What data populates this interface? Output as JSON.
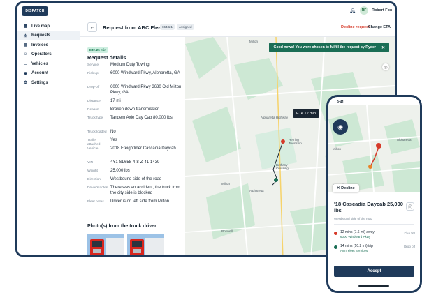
{
  "app": {
    "logo_text": "DISPATCH"
  },
  "sidebar": {
    "items": [
      {
        "label": "Live map",
        "icon": "map-icon"
      },
      {
        "label": "Requests",
        "icon": "warning-icon"
      },
      {
        "label": "Invoices",
        "icon": "invoice-icon"
      },
      {
        "label": "Operators",
        "icon": "operators-icon"
      },
      {
        "label": "Vehicles",
        "icon": "truck-icon"
      },
      {
        "label": "Account",
        "icon": "account-icon"
      },
      {
        "label": "Settings",
        "icon": "gear-icon"
      }
    ],
    "active_index": 1
  },
  "topbar": {
    "user_initials": "RF",
    "user_name": "Robert Fox"
  },
  "request": {
    "title": "Request from ABC Fleet",
    "id": "654321",
    "status": "Assigned",
    "decline_label": "Decline request",
    "eta_label": "Change ETA",
    "eta_badge": "ETA 25 min",
    "section_title": "Request details",
    "rows": [
      {
        "label": "Service",
        "value": "Medium Duty Towing"
      },
      {
        "label": "Pick up",
        "value": "6000 Windward Pkwy, Alpharetta, GA"
      },
      {
        "label": "Drop-off",
        "value": "6000 Windward Pkwy 3630 Old Milton Pkwy, GA"
      },
      {
        "label": "Distance",
        "value": "17 mi"
      },
      {
        "label": "Reason",
        "value": "Broken down transmission"
      },
      {
        "label": "Truck type",
        "value": "Tandem Axle Day Cab 80,000 lbs"
      },
      {
        "label": "Truck loaded",
        "value": "No"
      },
      {
        "label": "Trailer attached",
        "value": "Yes"
      },
      {
        "label": "Vehicle",
        "value": "2018 Freightliner Cascadia Daycab"
      },
      {
        "label": "VIN",
        "value": "4Y1-SL658-4-8-Z-41-1439"
      },
      {
        "label": "Weight",
        "value": "25,000 lbs"
      },
      {
        "label": "Direction",
        "value": "Westbound side of the road"
      },
      {
        "label": "Driver's notes",
        "value": "There was an accident, the truck from the city side is blocked"
      },
      {
        "label": "Fleet notes",
        "value": "Driver is on left side from Milton"
      }
    ],
    "photos_title": "Photo(s) from the truck driver"
  },
  "map": {
    "toast": "Good news! You were chosen to fulfill the request by Ryder",
    "eta_tooltip": "ETA 12 min",
    "labels": [
      "Milton",
      "Alpharetta",
      "Roswell",
      "Crabapple",
      "Alpharetta Highway",
      "Herring Township",
      "Bethany Crossing"
    ]
  },
  "phone": {
    "time": "9:41",
    "decline_label": "Decline",
    "vehicle_title": "'18 Cascadia Daycab 25,000 lbs",
    "direction": "Westbound side of the road",
    "stops": [
      {
        "eta": "12 mins (7.6 mi) away",
        "address": "6000 Windward Pkwy",
        "tag": "Pick Up",
        "color": "#d63a2a"
      },
      {
        "eta": "14 mins (10.2 mi) trip",
        "address": "AMT Fleet Services",
        "tag": "Drop off",
        "color": "#1a6e55"
      }
    ],
    "map_labels": [
      "Alpharetta",
      "Milton",
      "Roswell"
    ],
    "accept_label": "Accept"
  },
  "colors": {
    "brand": "#1f3a5a",
    "danger": "#d63a2a",
    "success": "#1a6e55"
  }
}
